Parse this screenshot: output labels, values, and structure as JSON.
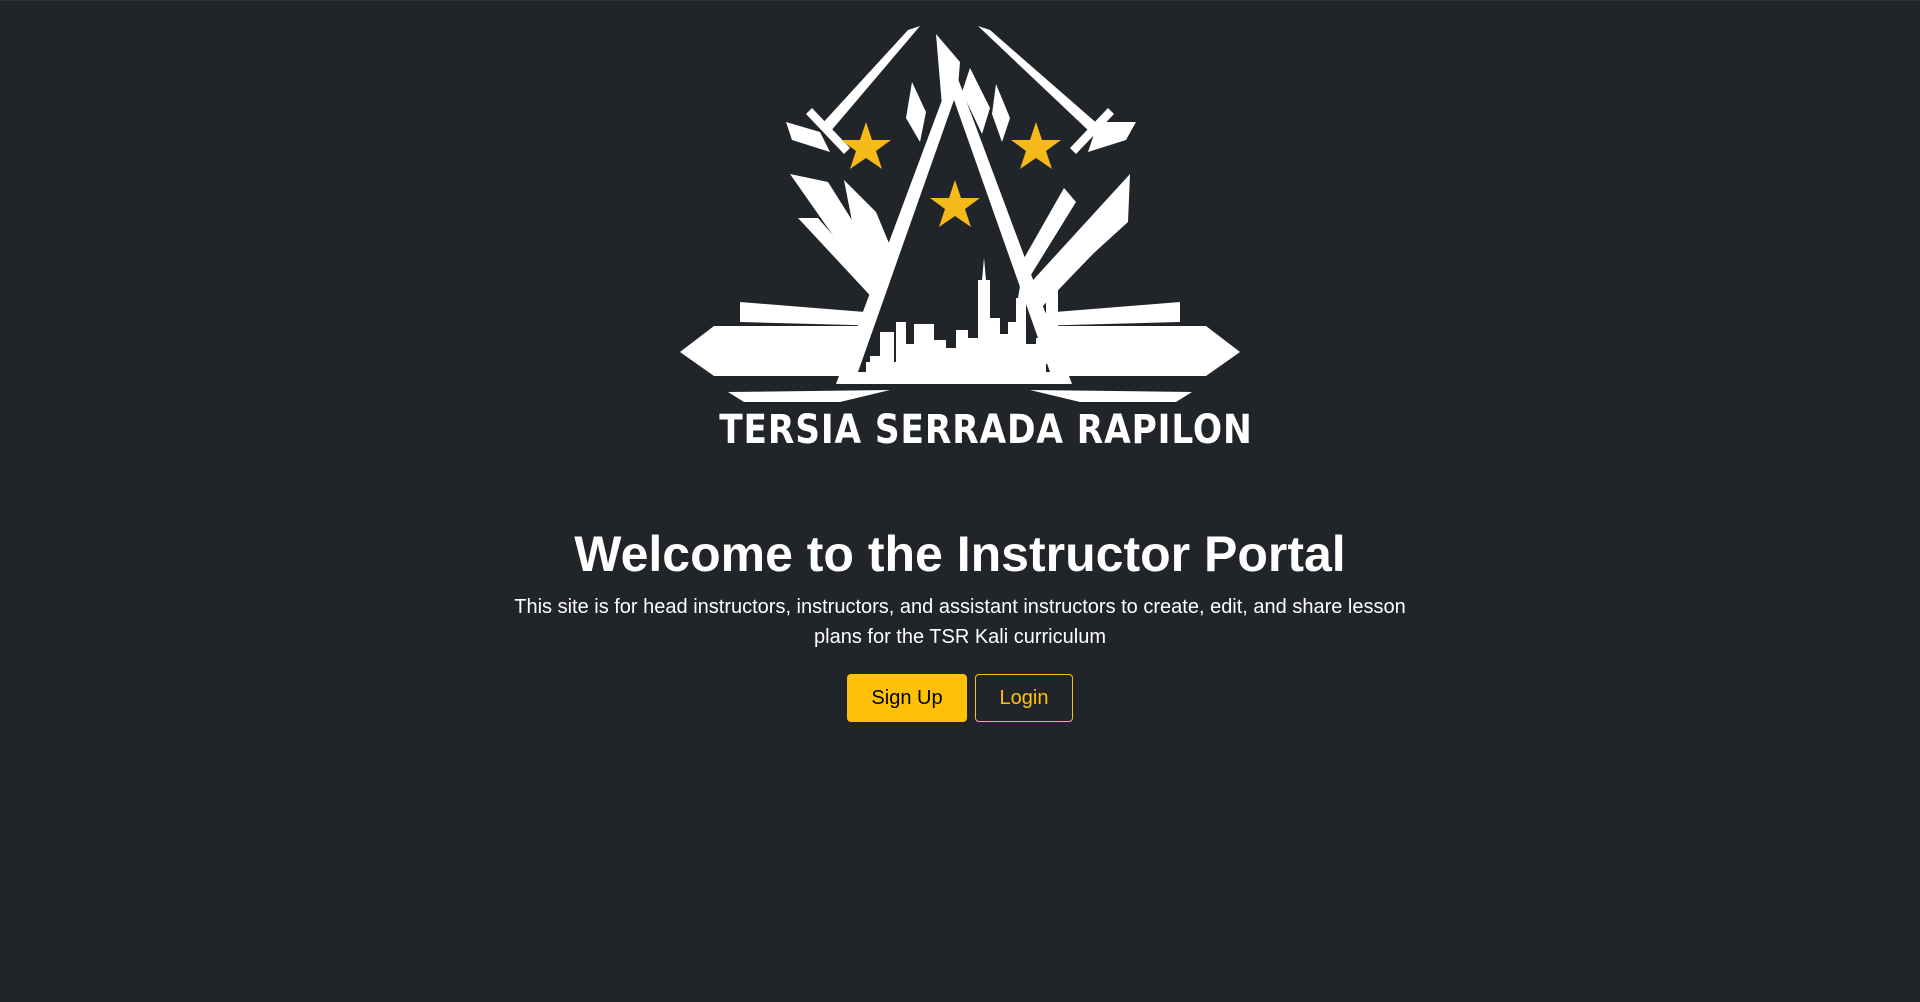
{
  "logo": {
    "brand_text": "TERSIA SERRADA RAPILON",
    "primary_color": "#ffffff",
    "star_color": "#f5b91a"
  },
  "hero": {
    "title": "Welcome to the Instructor Portal",
    "lead": "This site is for head instructors, instructors, and assistant instructors to create, edit, and share lesson plans for the TSR Kali curriculum"
  },
  "actions": {
    "signup_label": "Sign Up",
    "login_label": "Login",
    "accent_color": "#ffc107"
  },
  "theme": {
    "background": "#212529"
  }
}
